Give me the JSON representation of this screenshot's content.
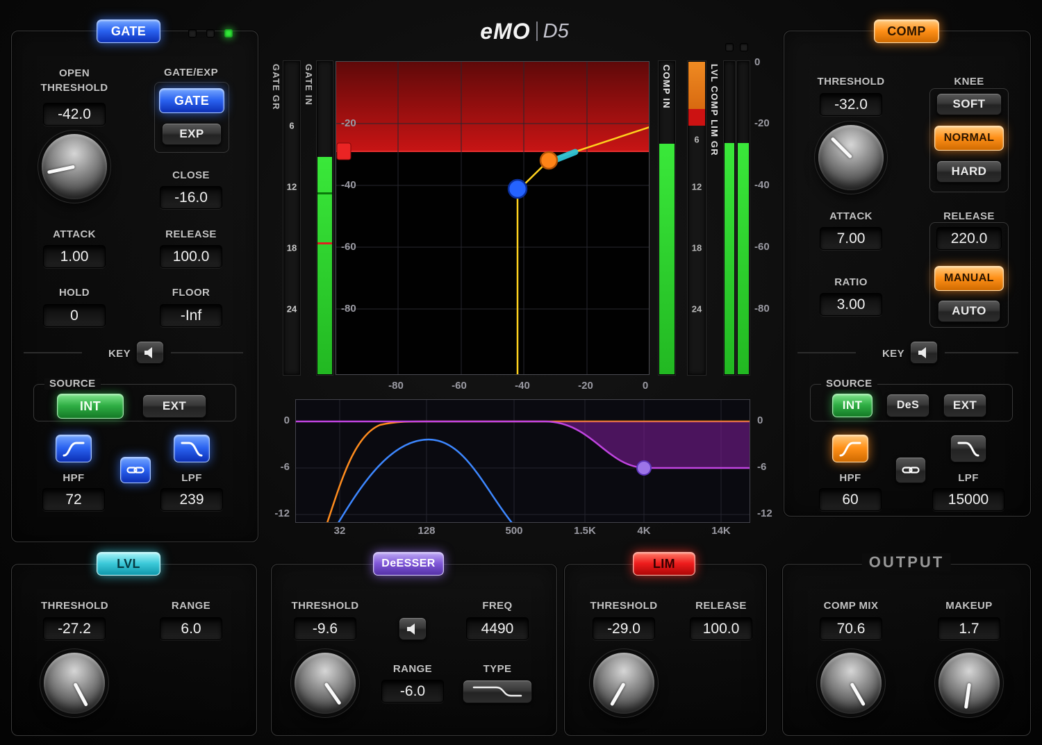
{
  "logo": {
    "brand": "eMO",
    "model": "D5"
  },
  "gate": {
    "section_label": "GATE",
    "open_threshold": {
      "label": "OPEN THRESHOLD",
      "value": "-42.0"
    },
    "mode": {
      "label": "GATE/EXP",
      "gate": "GATE",
      "exp": "EXP"
    },
    "close": {
      "label": "CLOSE",
      "value": "-16.0"
    },
    "attack": {
      "label": "ATTACK",
      "value": "1.00"
    },
    "release": {
      "label": "RELEASE",
      "value": "100.0"
    },
    "hold": {
      "label": "HOLD",
      "value": "0"
    },
    "floor": {
      "label": "FLOOR",
      "value": "-Inf"
    },
    "key_label": "KEY",
    "source": {
      "label": "SOURCE",
      "int": "INT",
      "ext": "EXT"
    },
    "hpf": {
      "label": "HPF",
      "value": "72"
    },
    "lpf": {
      "label": "LPF",
      "value": "239"
    }
  },
  "comp": {
    "section_label": "COMP",
    "threshold": {
      "label": "THRESHOLD",
      "value": "-32.0"
    },
    "knee": {
      "label": "KNEE",
      "soft": "SOFT",
      "normal": "NORMAL",
      "hard": "HARD"
    },
    "attack": {
      "label": "ATTACK",
      "value": "7.00"
    },
    "release": {
      "label": "RELEASE",
      "value": "220.0",
      "manual": "MANUAL",
      "auto": "AUTO"
    },
    "ratio": {
      "label": "RATIO",
      "value": "3.00"
    },
    "key_label": "KEY",
    "source": {
      "label": "SOURCE",
      "int": "INT",
      "des": "DeS",
      "ext": "EXT"
    },
    "hpf": {
      "label": "HPF",
      "value": "60"
    },
    "lpf": {
      "label": "LPF",
      "value": "15000"
    }
  },
  "meters": {
    "gate_gr_label": "GATE GR",
    "gate_in_label": "GATE IN",
    "comp_in_label": "COMP IN",
    "lvl_comp_lim_gr_label": "LVL COMP LIM GR",
    "gr_scale": [
      "6",
      "12",
      "18",
      "24"
    ],
    "db_scale": [
      "0",
      "-20",
      "-40",
      "-60",
      "-80"
    ]
  },
  "graph": {
    "x_ticks": [
      "-80",
      "-60",
      "-40",
      "-20",
      "0"
    ],
    "y_ticks": [
      "-20",
      "-40",
      "-60",
      "-80"
    ]
  },
  "eq_graph": {
    "db_ticks": [
      "0",
      "-6",
      "-12"
    ],
    "freq_ticks": [
      "32",
      "128",
      "500",
      "1.5K",
      "4K",
      "14K"
    ]
  },
  "lvl": {
    "section_label": "LVL",
    "threshold": {
      "label": "THRESHOLD",
      "value": "-27.2"
    },
    "range": {
      "label": "RANGE",
      "value": "6.0"
    }
  },
  "deesser": {
    "section_label": "DeESSER",
    "threshold": {
      "label": "THRESHOLD",
      "value": "-9.6"
    },
    "freq": {
      "label": "FREQ",
      "value": "4490"
    },
    "range": {
      "label": "RANGE",
      "value": "-6.0"
    },
    "type_label": "TYPE"
  },
  "lim": {
    "section_label": "LIM",
    "threshold": {
      "label": "THRESHOLD",
      "value": "-29.0"
    },
    "release": {
      "label": "RELEASE",
      "value": "100.0"
    }
  },
  "output": {
    "section_label": "OUTPUT",
    "comp_mix": {
      "label": "COMP MIX",
      "value": "70.6"
    },
    "makeup": {
      "label": "MAKEUP",
      "value": "1.7"
    }
  }
}
